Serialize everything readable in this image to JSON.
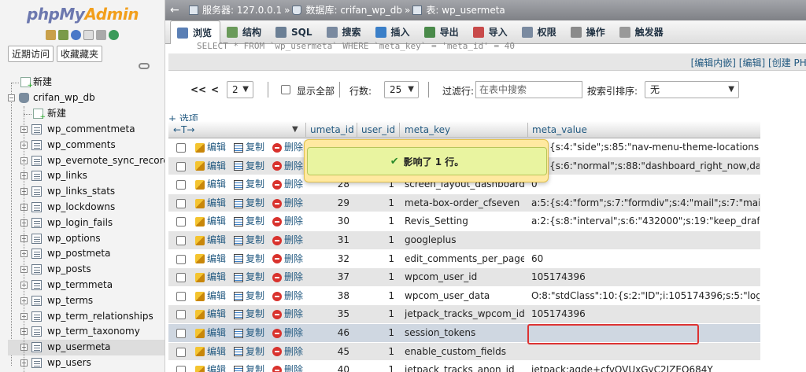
{
  "logo": {
    "php": "php",
    "my": "My",
    "admin": "Admin"
  },
  "nav_tabs": {
    "recent": "近期访问",
    "favorites": "收藏藏夹"
  },
  "tree": {
    "new_root": "新建",
    "db_name": "crifan_wp_db",
    "new_table": "新建",
    "tables": [
      "wp_commentmeta",
      "wp_comments",
      "wp_evernote_sync_record",
      "wp_links",
      "wp_links_stats",
      "wp_lockdowns",
      "wp_login_fails",
      "wp_options",
      "wp_postmeta",
      "wp_posts",
      "wp_termmeta",
      "wp_terms",
      "wp_term_relationships",
      "wp_term_taxonomy",
      "wp_usermeta",
      "wp_users"
    ],
    "active_table": "wp_usermeta"
  },
  "breadcrumb": {
    "back_arrow": "←",
    "server": "服务器: 127.0.0.1",
    "database": "数据库: crifan_wp_db",
    "table": "表: wp_usermeta",
    "sep": "»"
  },
  "menu": [
    {
      "label": "浏览",
      "icon": "browse-icon",
      "color": "#5a7fb5"
    },
    {
      "label": "结构",
      "icon": "structure-icon",
      "color": "#6a9a5a"
    },
    {
      "label": "SQL",
      "icon": "sql-icon",
      "color": "#6b7f95"
    },
    {
      "label": "搜索",
      "icon": "search-icon",
      "color": "#7a8aa0"
    },
    {
      "label": "插入",
      "icon": "insert-icon",
      "color": "#3a7fc8"
    },
    {
      "label": "导出",
      "icon": "export-icon",
      "color": "#4a8a4a"
    },
    {
      "label": "导入",
      "icon": "import-icon",
      "color": "#c84a4a"
    },
    {
      "label": "权限",
      "icon": "privileges-icon",
      "color": "#7a8aa0"
    },
    {
      "label": "操作",
      "icon": "operations-icon",
      "color": "#8a8a8a"
    },
    {
      "label": "触发器",
      "icon": "triggers-icon",
      "color": "#999999"
    }
  ],
  "sql_cutoff": "SELECT * FROM `wp_usermeta` WHERE `meta_key` = 'meta_id' = 40",
  "sql_links": {
    "open": "[",
    "edit_inline": "编辑内嵌",
    "sep1": "] [",
    "edit": "编辑",
    "sep2": "] [",
    "create": "创建 PHP"
  },
  "navigation": {
    "first": "<<",
    "prev": "<",
    "page": "2",
    "show_all": "显示全部",
    "rows_label": "行数:",
    "rows_value": "25",
    "filter_label": "过滤行:",
    "filter_placeholder": "在表中搜索",
    "sort_label": "按索引排序:",
    "sort_value": "无"
  },
  "options_link": "+ 选项",
  "table": {
    "arrows": "←T→",
    "headers": [
      "umeta_id",
      "user_id",
      "meta_key",
      "meta_value"
    ],
    "actions": {
      "edit": "编辑",
      "copy": "复制",
      "delete": "删除"
    },
    "rows": [
      {
        "umeta_id": "",
        "user_id": "",
        "meta_key": "",
        "meta_value": "a:5:{s:4:\"side\";s:85:\"nav-menu-theme-locations,add..."
      },
      {
        "umeta_id": "",
        "user_id": "",
        "meta_key": "",
        "meta_value": "a:5:{s:6:\"normal\";s:88:\"dashboard_right_now,dashbo..."
      },
      {
        "umeta_id": "28",
        "user_id": "1",
        "meta_key": "screen_layout_dashboard",
        "meta_value": "0"
      },
      {
        "umeta_id": "29",
        "user_id": "1",
        "meta_key": "meta-box-order_cfseven",
        "meta_value": "a:5:{s:4:\"form\";s:7:\"formdiv\";s:4:\"mail\";s:7:\"mail..."
      },
      {
        "umeta_id": "30",
        "user_id": "1",
        "meta_key": "Revis_Setting",
        "meta_value": "a:2:{s:8:\"interval\";s:6:\"432000\";s:19:\"keep_draft_..."
      },
      {
        "umeta_id": "31",
        "user_id": "1",
        "meta_key": "googleplus",
        "meta_value": ""
      },
      {
        "umeta_id": "32",
        "user_id": "1",
        "meta_key": "edit_comments_per_page",
        "meta_value": "60"
      },
      {
        "umeta_id": "37",
        "user_id": "1",
        "meta_key": "wpcom_user_id",
        "meta_value": "105174396"
      },
      {
        "umeta_id": "38",
        "user_id": "1",
        "meta_key": "wpcom_user_data",
        "meta_value": "O:8:\"stdClass\":10:{s:2:\"ID\";i:105174396;s:5:\"login..."
      },
      {
        "umeta_id": "35",
        "user_id": "1",
        "meta_key": "jetpack_tracks_wpcom_id",
        "meta_value": "105174396"
      },
      {
        "umeta_id": "46",
        "user_id": "1",
        "meta_key": "session_tokens",
        "meta_value": ""
      },
      {
        "umeta_id": "45",
        "user_id": "1",
        "meta_key": "enable_custom_fields",
        "meta_value": ""
      },
      {
        "umeta_id": "40",
        "user_id": "1",
        "meta_key": "jetpack_tracks_anon_id",
        "meta_value": "jetpack:aqde+cfvOVUxGyC2JZEQ684Y"
      }
    ]
  },
  "toast": {
    "message": "影响了 1 行。"
  },
  "colors": {
    "link": "#235a81",
    "highlight": "#dd3333",
    "toast_bg": "#e9f4a0"
  }
}
